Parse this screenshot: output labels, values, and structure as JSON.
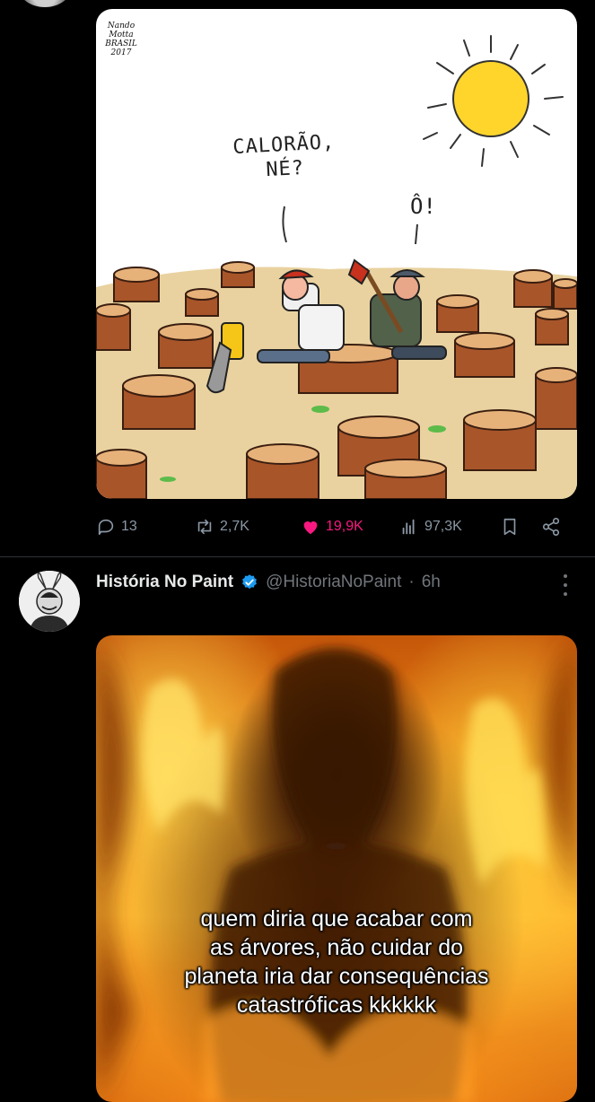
{
  "post1": {
    "cartoon": {
      "speech_line1": "CALORÃO,",
      "speech_line2": "NÉ?",
      "speech_reply": "Ô!",
      "signature": "Nando Motta BRASIL 2017"
    },
    "actions": {
      "replies": "13",
      "reposts": "2,7K",
      "likes": "19,9K",
      "views": "97,3K"
    },
    "colors": {
      "like": "#f91880",
      "icon": "#8b98a5"
    }
  },
  "post2": {
    "display_name": "História No Paint",
    "handle": "@HistoriaNoPaint",
    "separator": "·",
    "time": "6h",
    "image_caption": "quem diria que acabar com\nas árvores, não cuidar do\nplaneta iria dar consequências\ncatastróficas kkkkkk",
    "verified_color": "#1d9bf0"
  }
}
